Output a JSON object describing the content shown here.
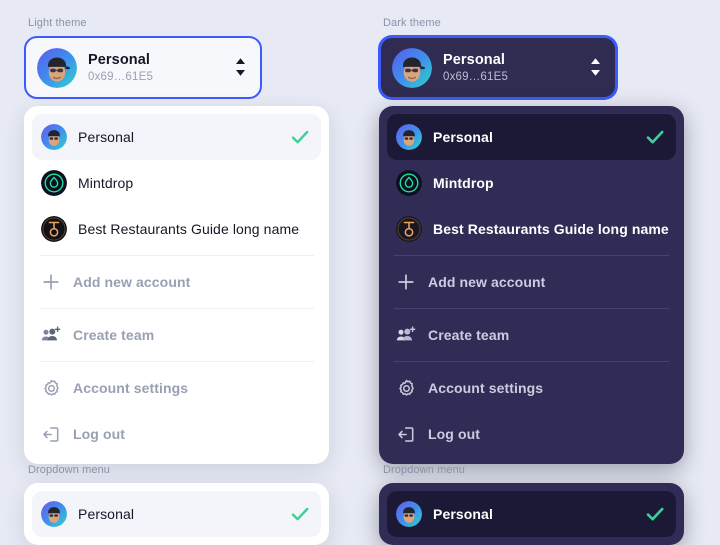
{
  "page": {
    "background_color": "#e7eaf4",
    "accent_border": "#3b5bfd",
    "check_color": "#3ecf96"
  },
  "sections": {
    "light_label": "Light theme",
    "dark_label": "Dark theme",
    "dropdown_label_light": "Dropdown menu",
    "dropdown_label_dark": "Dropdown menu"
  },
  "trigger": {
    "name": "Personal",
    "address": "0x69…61E5",
    "updown_icon": "chevron-up-down-icon"
  },
  "menu": {
    "accounts": [
      {
        "label": "Personal",
        "avatar": "personal-avatar",
        "selected": true,
        "check_icon": "check-icon"
      },
      {
        "label": "Mintdrop",
        "avatar": "mintdrop-avatar",
        "selected": false,
        "check_icon": ""
      },
      {
        "label": "Best Restaurants Guide long name",
        "avatar": "restaurants-avatar",
        "selected": false,
        "check_icon": ""
      }
    ],
    "actions": [
      {
        "label": "Add new account",
        "icon": "plus-icon"
      },
      {
        "label": "Create team",
        "icon": "add-users-icon"
      },
      {
        "label": "Account settings",
        "icon": "gear-icon"
      },
      {
        "label": "Log out",
        "icon": "logout-icon"
      }
    ]
  },
  "preview_row": {
    "label": "Personal",
    "avatar": "personal-avatar",
    "check_icon": "check-icon"
  }
}
